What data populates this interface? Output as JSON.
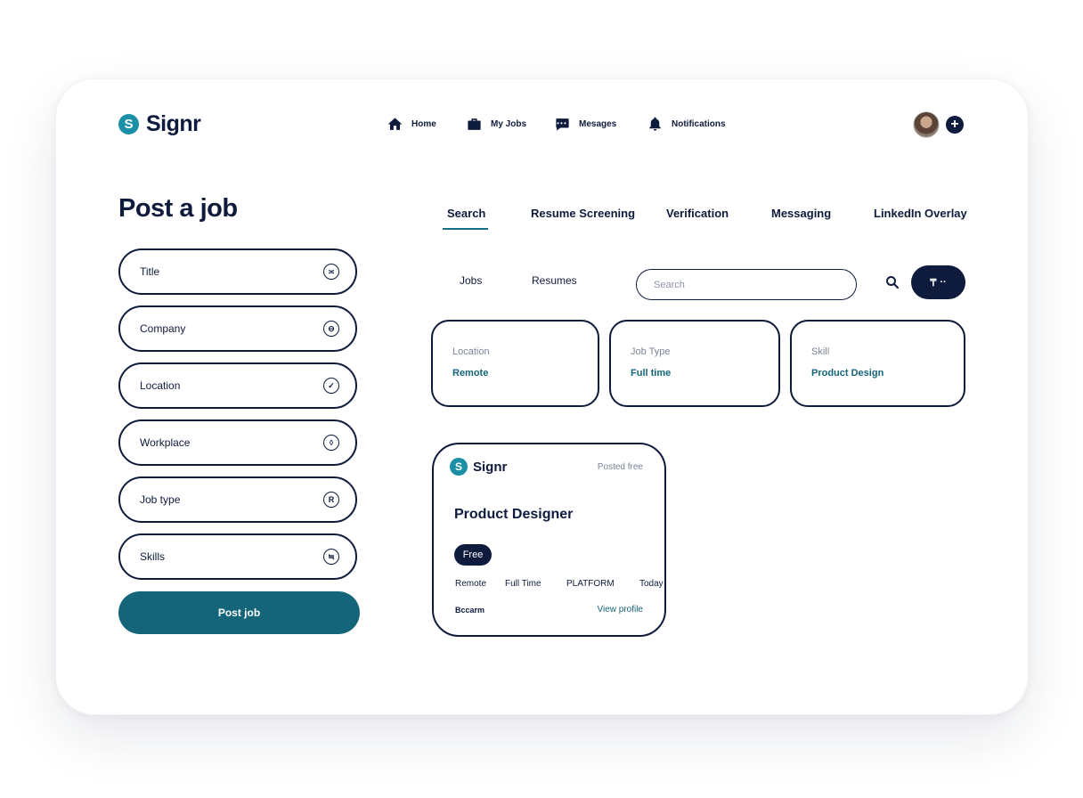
{
  "app": {
    "name": "Signr",
    "logo_letter": "S"
  },
  "nav": [
    {
      "label": "Home",
      "icon": "home-icon"
    },
    {
      "label": "My Jobs",
      "icon": "briefcase-icon"
    },
    {
      "label": "Mesages",
      "icon": "chat-icon"
    },
    {
      "label": "Notifications",
      "icon": "bell-icon"
    }
  ],
  "header": {
    "plus": "+"
  },
  "form": {
    "title": "Post a job",
    "fields": [
      {
        "label": "Title",
        "icon_glyph": "≍"
      },
      {
        "label": "Company",
        "icon_glyph": "⊖"
      },
      {
        "label": "Location",
        "icon_glyph": "✓"
      },
      {
        "label": "Workplace",
        "icon_glyph": "◊"
      },
      {
        "label": "Job type",
        "icon_glyph": "R"
      },
      {
        "label": "Skills",
        "icon_glyph": "≒"
      }
    ],
    "submit_label": "Post job"
  },
  "tabs": [
    "Search",
    "Resume Screening",
    "Verification",
    "Messaging",
    "LinkedIn Overlay"
  ],
  "active_tab": "Search",
  "subtabs": [
    "Jobs",
    "Resumes"
  ],
  "search": {
    "placeholder": "Search"
  },
  "filter_button": {
    "glyph": "₸",
    "label": "··"
  },
  "filters": [
    {
      "label": "Location",
      "value": "Remote"
    },
    {
      "label": "Job Type",
      "value": "Full time"
    },
    {
      "label": "Skill",
      "value": "Product Design"
    }
  ],
  "job_card": {
    "company_logo": "Signr",
    "posted": "Posted free",
    "title": "Product Designer",
    "badge": "Free",
    "meta": [
      "Remote",
      "Full Time",
      "PLATFORM",
      "Today"
    ],
    "company": "Bccarm",
    "link": "View profile"
  },
  "colors": {
    "navy": "#0f1b3d",
    "teal": "#14657a",
    "brand": "#1b8fa6"
  }
}
